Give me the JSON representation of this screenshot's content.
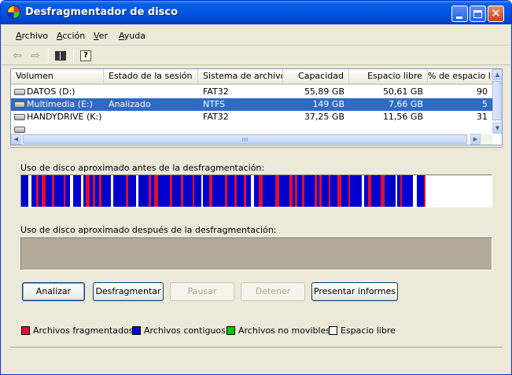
{
  "window": {
    "title": "Desfragmentador de disco"
  },
  "menu": [
    "Archivo",
    "Acción",
    "Ver",
    "Ayuda"
  ],
  "columns": [
    "Volumen",
    "Estado de la sesión",
    "Sistema de archivos",
    "Capacidad",
    "Espacio libre",
    "% de espacio l"
  ],
  "rows": [
    {
      "volume": "DATOS (D:)",
      "status": "",
      "fs": "FAT32",
      "capacity": "55,89 GB",
      "free": "50,61 GB",
      "pct": "90"
    },
    {
      "volume": "Multimedia (E:)",
      "status": "Analizado",
      "fs": "NTFS",
      "capacity": "149 GB",
      "free": "7,66 GB",
      "pct": "5"
    },
    {
      "volume": "HANDYDRIVE (K:)",
      "status": "",
      "fs": "FAT32",
      "capacity": "37,25 GB",
      "free": "11,56 GB",
      "pct": "31"
    }
  ],
  "selected_row": 1,
  "before_label": "Uso de disco aproximado antes de la desfragmentación:",
  "after_label": "Uso de disco aproximado después de la desfragmentación:",
  "buttons": {
    "analyze": "Analizar",
    "defragment": "Desfragmentar",
    "pause": "Pausar",
    "stop": "Detener",
    "report": "Presentar informes"
  },
  "legend": [
    {
      "label": "Archivos fragmentados",
      "color": "#e0102a"
    },
    {
      "label": "Archivos contiguos",
      "color": "#0000ce"
    },
    {
      "label": "Archivos no movibles",
      "color": "#00c800"
    },
    {
      "label": "Espacio libre",
      "color": "#ffffff"
    }
  ],
  "disk_map_before": {
    "used_fraction": 0.86,
    "free_color": "#ffffff"
  },
  "disk_map_after": {
    "color": "#b3ab98"
  }
}
